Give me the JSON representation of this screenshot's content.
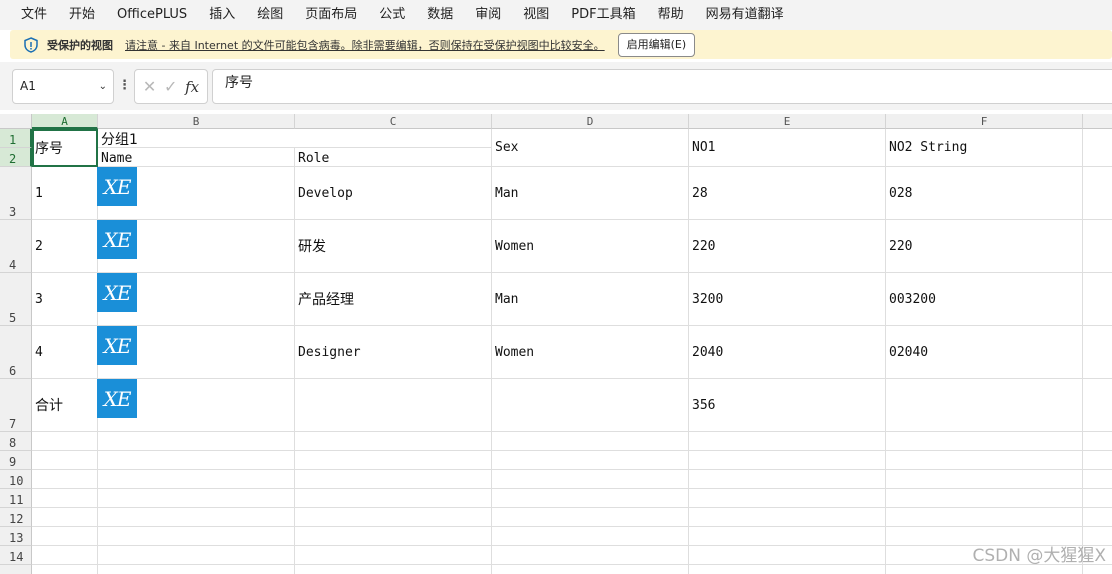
{
  "menu": [
    "文件",
    "开始",
    "OfficePLUS",
    "插入",
    "绘图",
    "页面布局",
    "公式",
    "数据",
    "审阅",
    "视图",
    "PDF工具箱",
    "帮助",
    "网易有道翻译"
  ],
  "protected_view": {
    "title": "受保护的视图",
    "message": "请注意 - 来自 Internet 的文件可能包含病毒。除非需要编辑，否则保持在受保护视图中比较安全。",
    "button": "启用编辑(E)"
  },
  "formula_bar": {
    "name_box": "A1",
    "formula": "序号"
  },
  "columns": [
    "A",
    "B",
    "C",
    "D",
    "E",
    "F"
  ],
  "rows": [
    "1",
    "2",
    "3",
    "4",
    "5",
    "6",
    "7",
    "8",
    "9",
    "10",
    "11",
    "12",
    "13",
    "14"
  ],
  "header": {
    "seq": "序号",
    "group": "分组1",
    "name": "Name",
    "role": "Role",
    "sex": "Sex",
    "no1": "NO1",
    "no2": "NO2 String"
  },
  "records": [
    {
      "seq": "1",
      "role": "Develop",
      "sex": "Man",
      "no1": "28",
      "no2": "028"
    },
    {
      "seq": "2",
      "role": "研发",
      "sex": "Women",
      "no1": "220",
      "no2": "220"
    },
    {
      "seq": "3",
      "role": "产品经理",
      "sex": "Man",
      "no1": "3200",
      "no2": "003200"
    },
    {
      "seq": "4",
      "role": "Designer",
      "sex": "Women",
      "no1": "2040",
      "no2": "02040"
    }
  ],
  "total": {
    "label": "合计",
    "no1": "356"
  },
  "image_text": "XE",
  "watermark": "CSDN @大猩猩X",
  "colors": {
    "selection": "#217346",
    "image_bg": "#1a8fd8",
    "protected_bar": "#fdf4d0"
  }
}
